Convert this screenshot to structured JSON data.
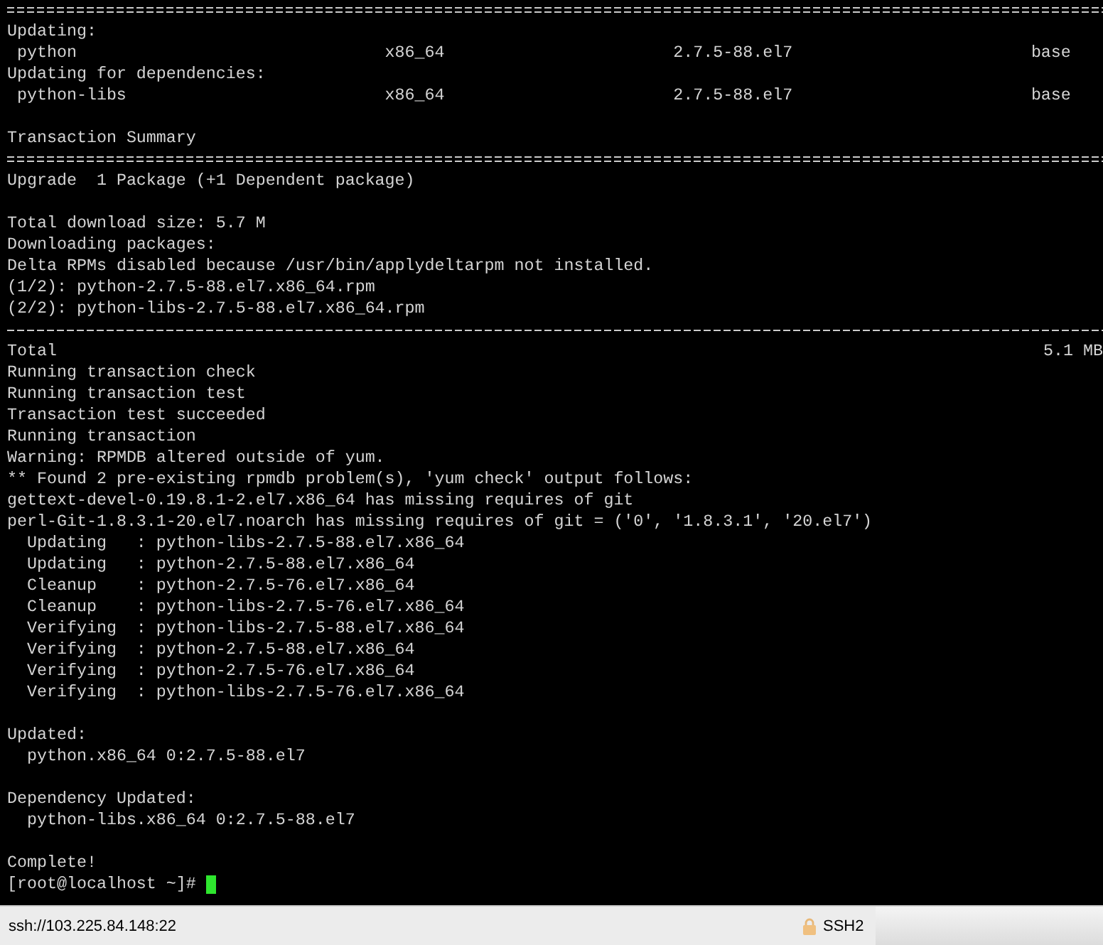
{
  "terminal": {
    "lines": [
      {
        "kind": "double-rule"
      },
      {
        "kind": "text",
        "text": "Updating:"
      },
      {
        "kind": "columns",
        "cells": [
          "python",
          "x86_64",
          "2.7.5-88.el7",
          "base"
        ]
      },
      {
        "kind": "text",
        "text": "Updating for dependencies:"
      },
      {
        "kind": "columns",
        "cells": [
          "python-libs",
          "x86_64",
          "2.7.5-88.el7",
          "base"
        ]
      },
      {
        "kind": "blank"
      },
      {
        "kind": "text",
        "text": "Transaction Summary"
      },
      {
        "kind": "double-rule"
      },
      {
        "kind": "text",
        "text": "Upgrade  1 Package (+1 Dependent package)"
      },
      {
        "kind": "blank"
      },
      {
        "kind": "text",
        "text": "Total download size: 5.7 M"
      },
      {
        "kind": "text",
        "text": "Downloading packages:"
      },
      {
        "kind": "text",
        "text": "Delta RPMs disabled because /usr/bin/applydeltarpm not installed."
      },
      {
        "kind": "text",
        "text": "(1/2): python-2.7.5-88.el7.x86_64.rpm"
      },
      {
        "kind": "text",
        "text": "(2/2): python-libs-2.7.5-88.el7.x86_64.rpm"
      },
      {
        "kind": "dashed-rule"
      },
      {
        "kind": "split",
        "left": "Total",
        "right": "5.1 MB"
      },
      {
        "kind": "text",
        "text": "Running transaction check"
      },
      {
        "kind": "text",
        "text": "Running transaction test"
      },
      {
        "kind": "text",
        "text": "Transaction test succeeded"
      },
      {
        "kind": "text",
        "text": "Running transaction"
      },
      {
        "kind": "text",
        "text": "Warning: RPMDB altered outside of yum."
      },
      {
        "kind": "text",
        "text": "** Found 2 pre-existing rpmdb problem(s), 'yum check' output follows:"
      },
      {
        "kind": "text",
        "text": "gettext-devel-0.19.8.1-2.el7.x86_64 has missing requires of git"
      },
      {
        "kind": "text",
        "text": "perl-Git-1.8.3.1-20.el7.noarch has missing requires of git = ('0', '1.8.3.1', '20.el7')"
      },
      {
        "kind": "text",
        "text": "  Updating   : python-libs-2.7.5-88.el7.x86_64"
      },
      {
        "kind": "text",
        "text": "  Updating   : python-2.7.5-88.el7.x86_64"
      },
      {
        "kind": "text",
        "text": "  Cleanup    : python-2.7.5-76.el7.x86_64"
      },
      {
        "kind": "text",
        "text": "  Cleanup    : python-libs-2.7.5-76.el7.x86_64"
      },
      {
        "kind": "text",
        "text": "  Verifying  : python-libs-2.7.5-88.el7.x86_64"
      },
      {
        "kind": "text",
        "text": "  Verifying  : python-2.7.5-88.el7.x86_64"
      },
      {
        "kind": "text",
        "text": "  Verifying  : python-2.7.5-76.el7.x86_64"
      },
      {
        "kind": "text",
        "text": "  Verifying  : python-libs-2.7.5-76.el7.x86_64"
      },
      {
        "kind": "blank"
      },
      {
        "kind": "text",
        "text": "Updated:"
      },
      {
        "kind": "text",
        "text": "  python.x86_64 0:2.7.5-88.el7"
      },
      {
        "kind": "blank"
      },
      {
        "kind": "text",
        "text": "Dependency Updated:"
      },
      {
        "kind": "text",
        "text": "  python-libs.x86_64 0:2.7.5-88.el7"
      },
      {
        "kind": "blank"
      },
      {
        "kind": "text",
        "text": "Complete!"
      },
      {
        "kind": "prompt",
        "text": "[root@localhost ~]#",
        "cursor": true
      }
    ]
  },
  "status_bar": {
    "connection": "ssh://103.225.84.148:22",
    "protocol": "SSH2",
    "secure": true
  }
}
